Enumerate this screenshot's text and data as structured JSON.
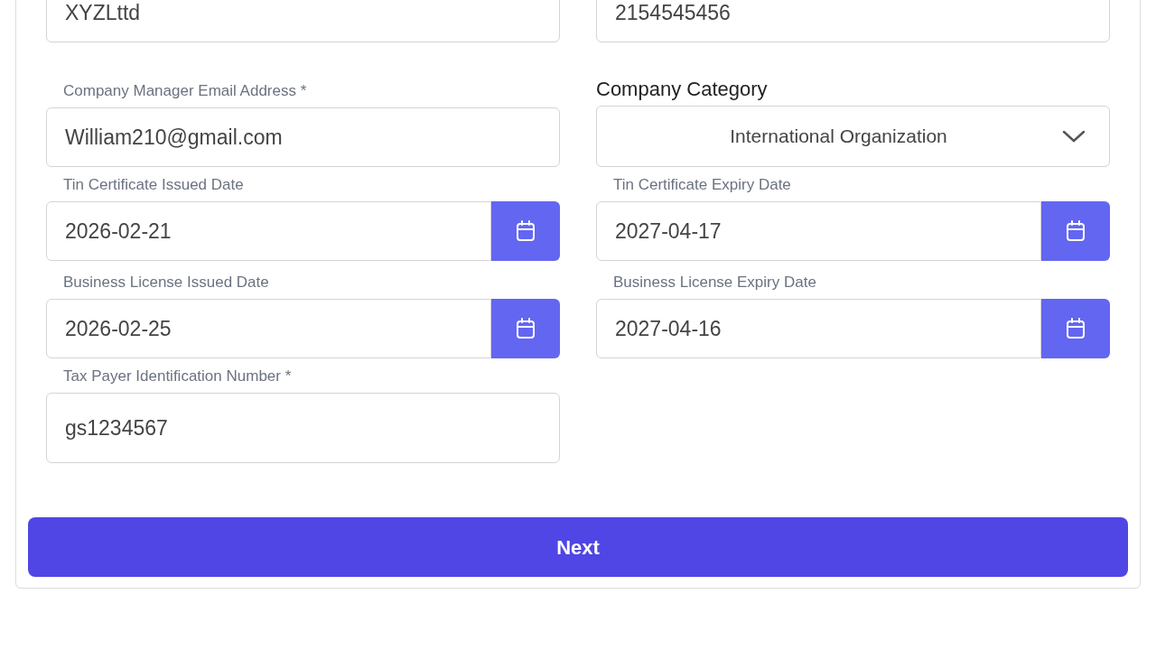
{
  "rows": [
    [
      {
        "kind": "text",
        "value": "XYZLttd"
      },
      {
        "kind": "text",
        "value": "2154545456"
      }
    ],
    [
      {
        "kind": "text",
        "label": "Company Manager Email Address *",
        "label_heading": false,
        "value": "William210@gmail.com"
      },
      {
        "kind": "select",
        "label": "Company Category",
        "label_heading": true,
        "value": "International Organization"
      }
    ],
    [
      {
        "kind": "date",
        "label": "Tin Certificate Issued Date",
        "label_heading": false,
        "value": "2026-02-21"
      },
      {
        "kind": "date",
        "label": "Tin Certificate Expiry Date",
        "label_heading": false,
        "value": "2027-04-17"
      }
    ],
    [
      {
        "kind": "date",
        "label": "Business License Issued Date",
        "label_heading": false,
        "value": "2026-02-25"
      },
      {
        "kind": "date",
        "label": "Business License Expiry Date",
        "label_heading": false,
        "value": "2027-04-16"
      }
    ],
    [
      {
        "kind": "text",
        "label": "Tax Payer Identification Number *",
        "label_heading": false,
        "value": "gs1234567"
      }
    ]
  ],
  "button": "Next"
}
